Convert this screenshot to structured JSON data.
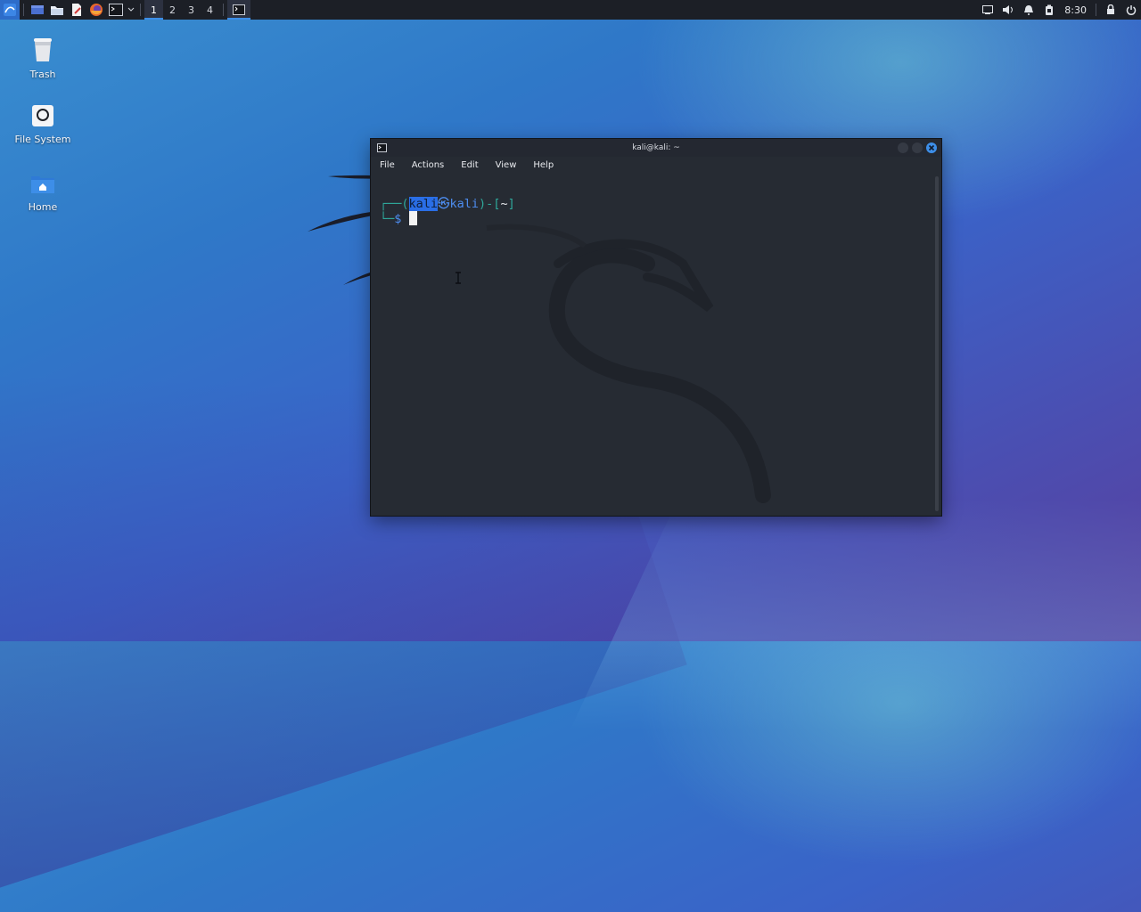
{
  "taskbar": {
    "workspaces": [
      "1",
      "2",
      "3",
      "4"
    ],
    "active_workspace": "1",
    "clock": "8:30",
    "launchers": [
      "kali-menu-icon",
      "desktop-icon",
      "files-icon",
      "text-editor-icon",
      "firefox-icon",
      "terminal-icon"
    ],
    "tray_icons": [
      "display-icon",
      "volume-icon",
      "bell-icon",
      "battery-icon",
      "lock-icon",
      "power-icon"
    ]
  },
  "desktop": {
    "icons": [
      {
        "label": "Trash"
      },
      {
        "label": "File System"
      },
      {
        "label": "Home"
      }
    ]
  },
  "terminal": {
    "title": "kali@kali: ~",
    "menu": [
      "File",
      "Actions",
      "Edit",
      "View",
      "Help"
    ],
    "prompt": {
      "open": "┌──(",
      "user": "kali",
      "at": "㉿",
      "host": "kali",
      "mid": ")-[",
      "dir": "~",
      "close": "]",
      "second": "└─",
      "dollar": "$"
    }
  },
  "colors": {
    "accent": "#3d8ee8",
    "terminal_bg": "#262b33",
    "prompt_green": "#2fa89b",
    "prompt_blue": "#4d8df0",
    "close_button": "#3d8ee8"
  }
}
